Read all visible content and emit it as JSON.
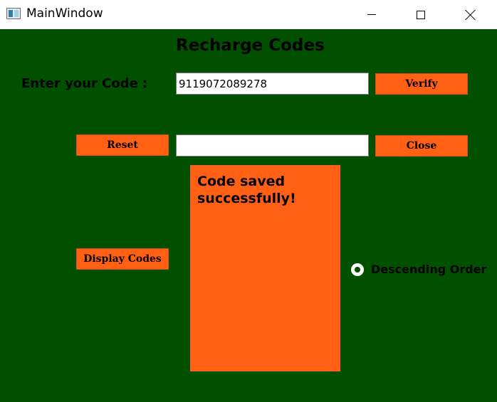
{
  "window": {
    "title": "MainWindow",
    "icon": "app-window-icon"
  },
  "controls": {
    "minimize": "minimize-icon",
    "maximize": "maximize-icon",
    "close": "close-icon"
  },
  "colors": {
    "background": "#005000",
    "button": "#ff6014",
    "panel": "#ff6014"
  },
  "main": {
    "heading": "Recharge Codes",
    "code_label": "Enter your Code :",
    "code_value": "9119072089278",
    "result_value": "",
    "verify_label": "Verify",
    "reset_label": "Reset",
    "close_label": "Close",
    "display_label": "Display Codes",
    "message": "Code saved successfully!",
    "order_option": "Descending Order",
    "order_selected": true
  }
}
